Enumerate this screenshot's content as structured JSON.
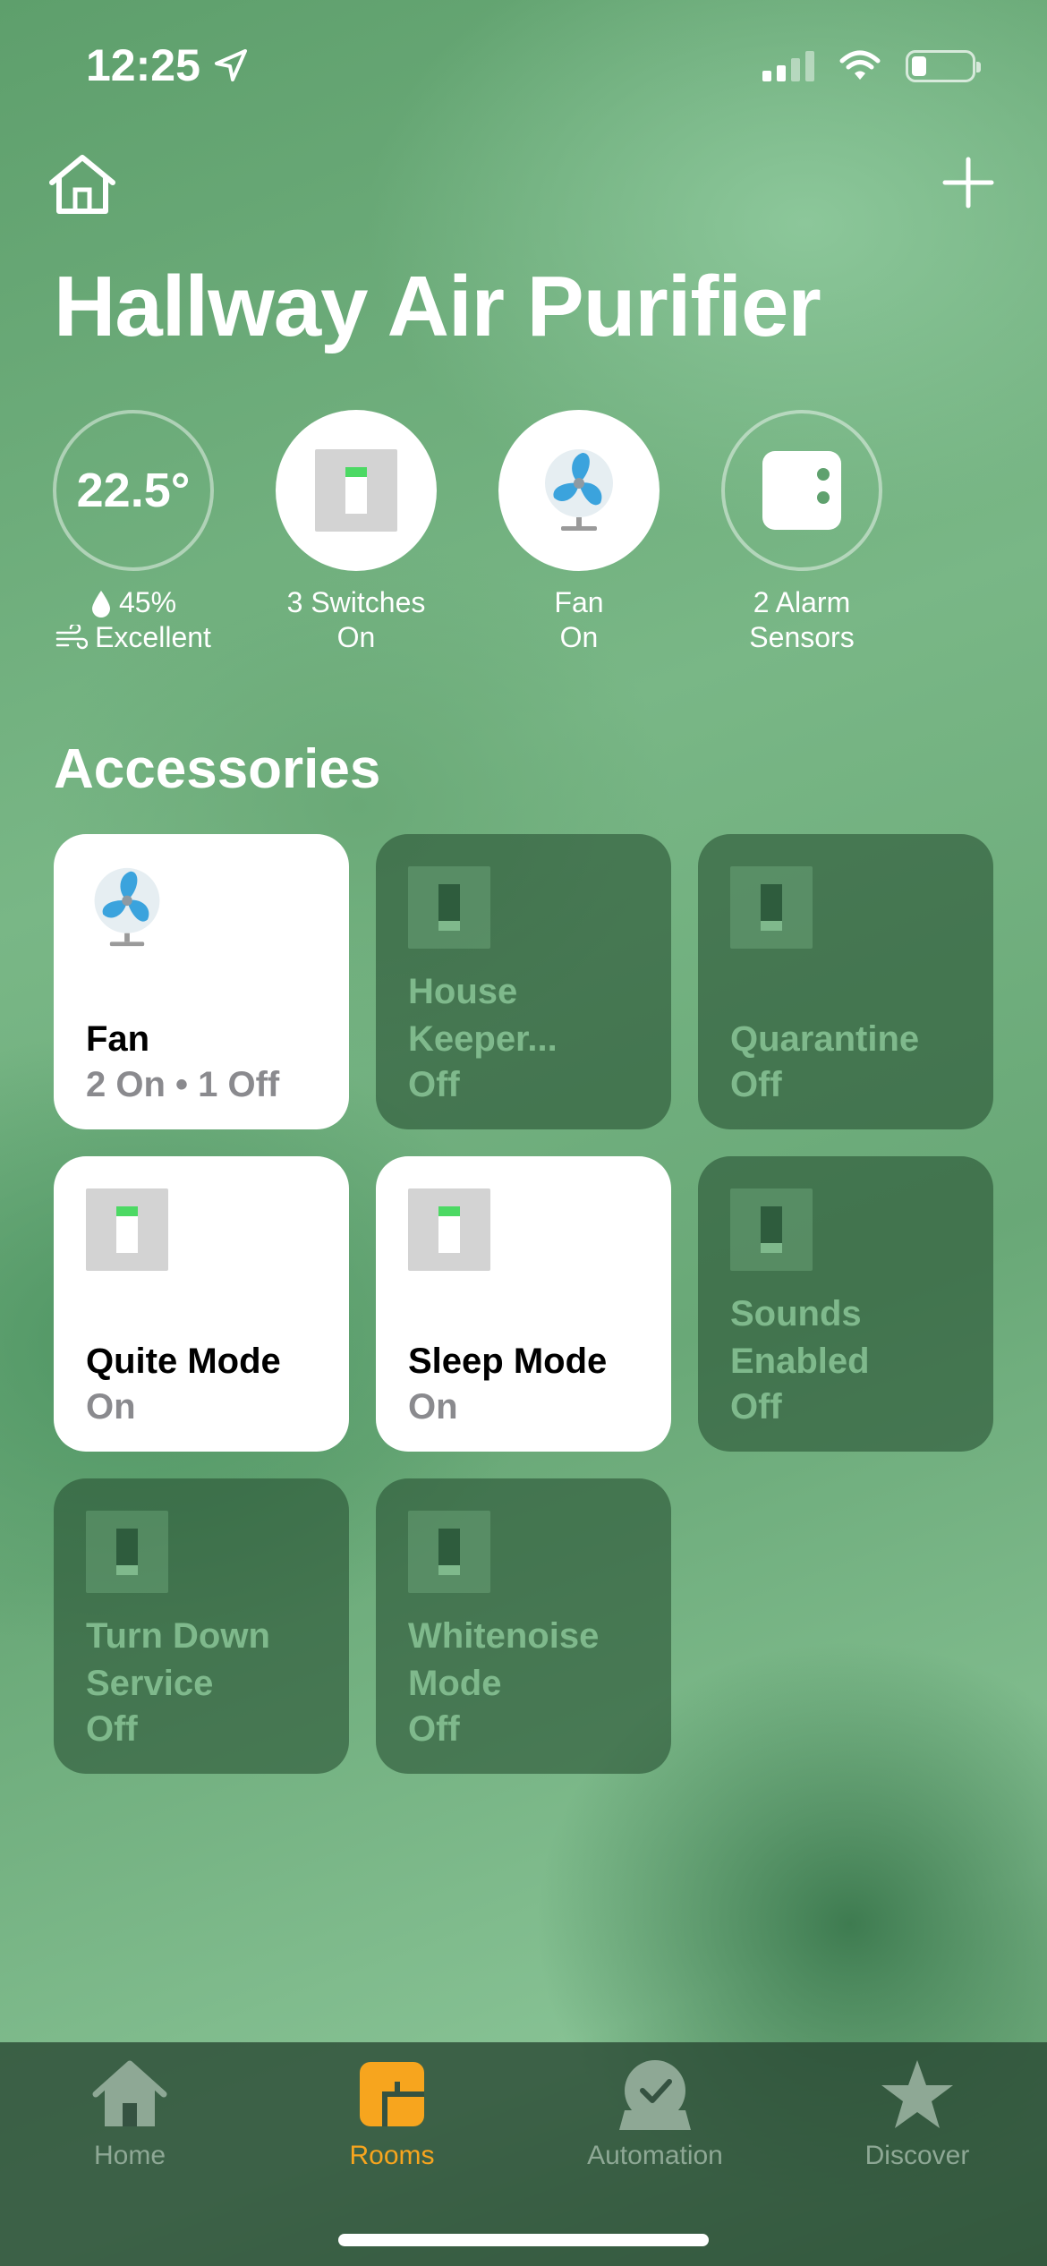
{
  "status_bar": {
    "time": "12:25"
  },
  "header": {
    "title": "Hallway Air Purifier"
  },
  "status": {
    "climate": {
      "temperature": "22.5°",
      "humidity": "45%",
      "air_quality": "Excellent"
    },
    "switches": {
      "line1": "3 Switches",
      "line2": "On"
    },
    "fan": {
      "line1": "Fan",
      "line2": "On"
    },
    "alarm": {
      "line1": "2 Alarm",
      "line2": "Sensors"
    }
  },
  "accessories": {
    "title": "Accessories",
    "tiles": [
      {
        "name": "Fan",
        "state": "2 On • 1 Off",
        "icon": "fan-icon",
        "on": true
      },
      {
        "name": "House Keeper...",
        "state": "Off",
        "icon": "switch-off-icon",
        "on": false
      },
      {
        "name": "Quarantine",
        "state": "Off",
        "icon": "switch-off-icon",
        "on": false
      },
      {
        "name": "Quite Mode",
        "state": "On",
        "icon": "switch-on-icon",
        "on": true
      },
      {
        "name": "Sleep Mode",
        "state": "On",
        "icon": "switch-on-icon",
        "on": true
      },
      {
        "name": "Sounds Enabled",
        "state": "Off",
        "icon": "switch-off-icon",
        "on": false
      },
      {
        "name": "Turn Down Service",
        "state": "Off",
        "icon": "switch-off-icon",
        "on": false
      },
      {
        "name": "Whitenoise Mode",
        "state": "Off",
        "icon": "switch-off-icon",
        "on": false
      }
    ]
  },
  "tabbar": {
    "tabs": [
      {
        "label": "Home",
        "icon": "home-icon",
        "active": false
      },
      {
        "label": "Rooms",
        "icon": "rooms-icon",
        "active": true
      },
      {
        "label": "Automation",
        "icon": "automation-icon",
        "active": false
      },
      {
        "label": "Discover",
        "icon": "star-icon",
        "active": false
      }
    ]
  },
  "colors": {
    "accent": "#f7a51e",
    "switch_on": "#4cd964",
    "fan_blue": "#3ba3dd"
  }
}
